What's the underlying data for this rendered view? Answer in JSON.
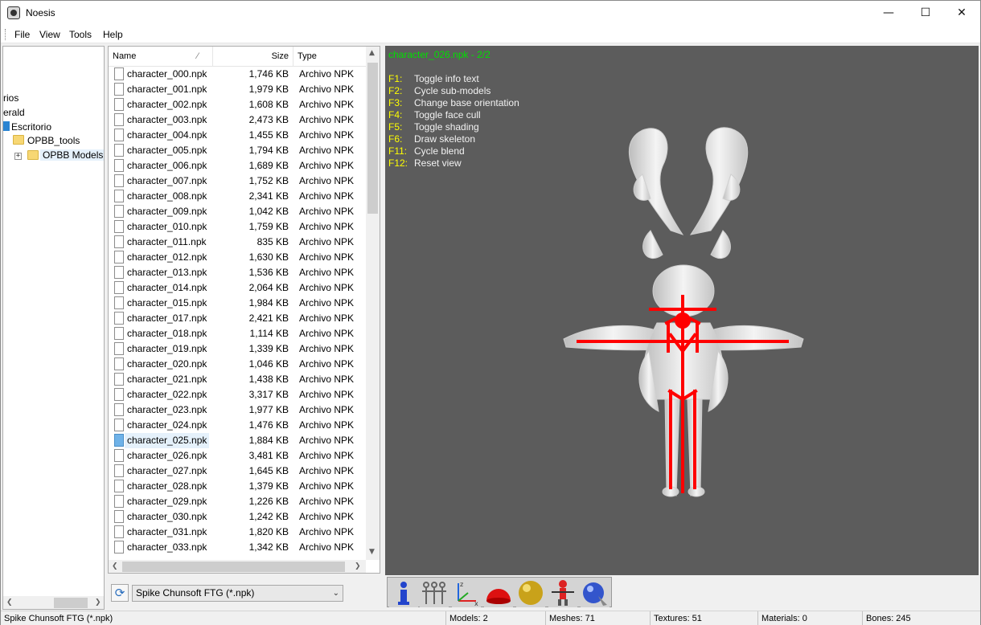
{
  "window": {
    "title": "Noesis"
  },
  "menu": [
    "File",
    "View",
    "Tools",
    "Help"
  ],
  "tree": {
    "items": [
      {
        "label": "rios"
      },
      {
        "label": "erald"
      },
      {
        "label": "Escritorio"
      },
      {
        "label": "OPBB_tools"
      },
      {
        "label": "OPBB Models"
      }
    ]
  },
  "filelist": {
    "columns": {
      "name": "Name",
      "size": "Size",
      "type": "Type"
    },
    "selected_index": 24,
    "rows": [
      {
        "name": "character_000.npk",
        "size": "1,746 KB",
        "type": "Archivo NPK"
      },
      {
        "name": "character_001.npk",
        "size": "1,979 KB",
        "type": "Archivo NPK"
      },
      {
        "name": "character_002.npk",
        "size": "1,608 KB",
        "type": "Archivo NPK"
      },
      {
        "name": "character_003.npk",
        "size": "2,473 KB",
        "type": "Archivo NPK"
      },
      {
        "name": "character_004.npk",
        "size": "1,455 KB",
        "type": "Archivo NPK"
      },
      {
        "name": "character_005.npk",
        "size": "1,794 KB",
        "type": "Archivo NPK"
      },
      {
        "name": "character_006.npk",
        "size": "1,689 KB",
        "type": "Archivo NPK"
      },
      {
        "name": "character_007.npk",
        "size": "1,752 KB",
        "type": "Archivo NPK"
      },
      {
        "name": "character_008.npk",
        "size": "2,341 KB",
        "type": "Archivo NPK"
      },
      {
        "name": "character_009.npk",
        "size": "1,042 KB",
        "type": "Archivo NPK"
      },
      {
        "name": "character_010.npk",
        "size": "1,759 KB",
        "type": "Archivo NPK"
      },
      {
        "name": "character_011.npk",
        "size": "835 KB",
        "type": "Archivo NPK"
      },
      {
        "name": "character_012.npk",
        "size": "1,630 KB",
        "type": "Archivo NPK"
      },
      {
        "name": "character_013.npk",
        "size": "1,536 KB",
        "type": "Archivo NPK"
      },
      {
        "name": "character_014.npk",
        "size": "2,064 KB",
        "type": "Archivo NPK"
      },
      {
        "name": "character_015.npk",
        "size": "1,984 KB",
        "type": "Archivo NPK"
      },
      {
        "name": "character_017.npk",
        "size": "2,421 KB",
        "type": "Archivo NPK"
      },
      {
        "name": "character_018.npk",
        "size": "1,114 KB",
        "type": "Archivo NPK"
      },
      {
        "name": "character_019.npk",
        "size": "1,339 KB",
        "type": "Archivo NPK"
      },
      {
        "name": "character_020.npk",
        "size": "1,046 KB",
        "type": "Archivo NPK"
      },
      {
        "name": "character_021.npk",
        "size": "1,438 KB",
        "type": "Archivo NPK"
      },
      {
        "name": "character_022.npk",
        "size": "3,317 KB",
        "type": "Archivo NPK"
      },
      {
        "name": "character_023.npk",
        "size": "1,977 KB",
        "type": "Archivo NPK"
      },
      {
        "name": "character_024.npk",
        "size": "1,476 KB",
        "type": "Archivo NPK"
      },
      {
        "name": "character_025.npk",
        "size": "1,884 KB",
        "type": "Archivo NPK"
      },
      {
        "name": "character_026.npk",
        "size": "3,481 KB",
        "type": "Archivo NPK"
      },
      {
        "name": "character_027.npk",
        "size": "1,645 KB",
        "type": "Archivo NPK"
      },
      {
        "name": "character_028.npk",
        "size": "1,379 KB",
        "type": "Archivo NPK"
      },
      {
        "name": "character_029.npk",
        "size": "1,226 KB",
        "type": "Archivo NPK"
      },
      {
        "name": "character_030.npk",
        "size": "1,242 KB",
        "type": "Archivo NPK"
      },
      {
        "name": "character_031.npk",
        "size": "1,820 KB",
        "type": "Archivo NPK"
      },
      {
        "name": "character_033.npk",
        "size": "1,342 KB",
        "type": "Archivo NPK"
      }
    ]
  },
  "format": {
    "selected": "Spike Chunsoft FTG (*.npk)"
  },
  "viewport": {
    "title": "character_026.npk - 2/2",
    "shortcuts": [
      {
        "key": "F1:",
        "desc": "Toggle info text"
      },
      {
        "key": "F2:",
        "desc": "Cycle sub-models"
      },
      {
        "key": "F3:",
        "desc": "Change base orientation"
      },
      {
        "key": "F4:",
        "desc": "Toggle face cull"
      },
      {
        "key": "F5:",
        "desc": "Toggle shading"
      },
      {
        "key": "F6:",
        "desc": "Draw skeleton"
      },
      {
        "key": "F11:",
        "desc": "Cycle blend"
      },
      {
        "key": "F12:",
        "desc": "Reset view"
      }
    ],
    "colors": {
      "background": "#5c5c5c",
      "title": "#00e000",
      "keys": "#ffff00",
      "text": "#f2f2f2",
      "skeleton": "#ff0000"
    }
  },
  "toolbar": {
    "buttons": [
      "info-icon",
      "skeletons-icon",
      "axes-icon",
      "dome-icon",
      "sphere-icon",
      "rig-icon",
      "material-sphere-icon"
    ]
  },
  "status": {
    "text": "Spike Chunsoft FTG (*.npk)",
    "models": "Models: 2",
    "meshes": "Meshes: 71",
    "textures": "Textures: 51",
    "materials": "Materials: 0",
    "bones": "Bones: 245"
  }
}
